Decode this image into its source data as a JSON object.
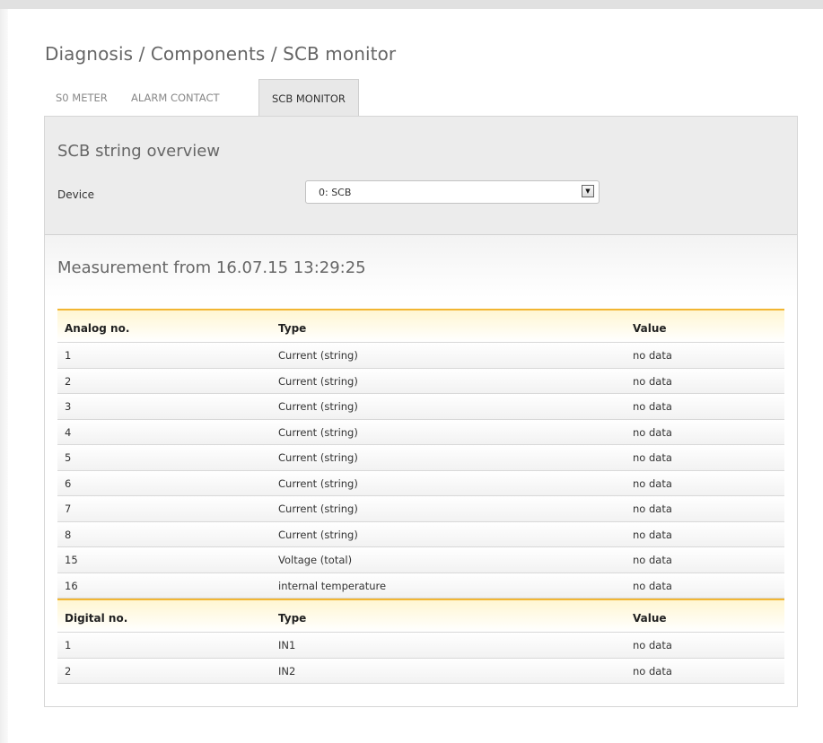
{
  "breadcrumb": "Diagnosis / Components / SCB monitor",
  "tabs": [
    {
      "label": "S0 METER",
      "active": false
    },
    {
      "label": "ALARM CONTACT",
      "active": false
    },
    {
      "label": "SCB MONITOR",
      "active": true
    }
  ],
  "overview": {
    "title": "SCB string overview",
    "device_label": "Device",
    "device_value": "0: SCB"
  },
  "measurement": {
    "title": "Measurement from 16.07.15 13:29:25"
  },
  "analog": {
    "headers": [
      "Analog no.",
      "Type",
      "Value"
    ],
    "rows": [
      [
        "1",
        "Current (string)",
        "no data"
      ],
      [
        "2",
        "Current (string)",
        "no data"
      ],
      [
        "3",
        "Current (string)",
        "no data"
      ],
      [
        "4",
        "Current (string)",
        "no data"
      ],
      [
        "5",
        "Current (string)",
        "no data"
      ],
      [
        "6",
        "Current (string)",
        "no data"
      ],
      [
        "7",
        "Current (string)",
        "no data"
      ],
      [
        "8",
        "Current (string)",
        "no data"
      ],
      [
        "15",
        "Voltage (total)",
        "no data"
      ],
      [
        "16",
        "internal temperature",
        "no data"
      ]
    ]
  },
  "digital": {
    "headers": [
      "Digital no.",
      "Type",
      "Value"
    ],
    "rows": [
      [
        "1",
        "IN1",
        "no data"
      ],
      [
        "2",
        "IN2",
        "no data"
      ]
    ]
  },
  "colors": {
    "accent": "#f2b632",
    "panel_bg": "#ececec"
  },
  "icons": {
    "select_arrow": "chevron-down-icon"
  }
}
